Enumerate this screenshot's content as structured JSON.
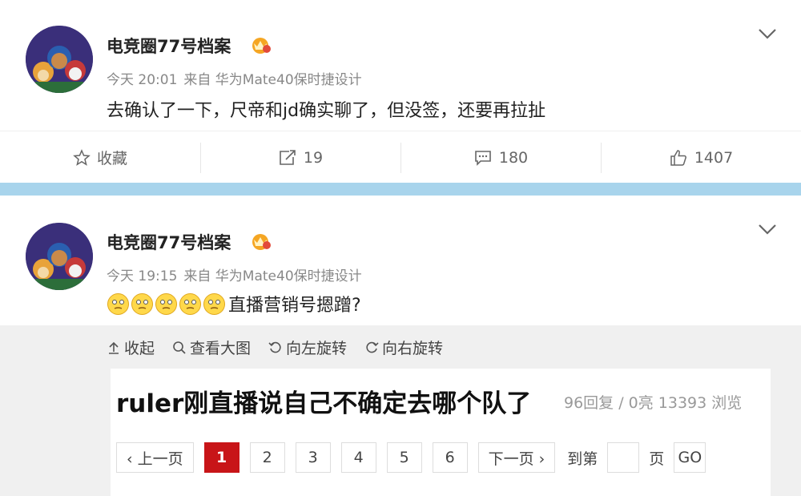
{
  "posts": [
    {
      "username": "电竞圈77号档案",
      "time": "今天 20:01",
      "source": "来自 华为Mate40保时捷设计",
      "content": "去确认了一下，尺帝和jd确实聊了，但没签，还要再拉扯",
      "actions": {
        "favorite": "收藏",
        "repost": "19",
        "comment": "180",
        "like": "1407"
      }
    },
    {
      "username": "电竞圈77号档案",
      "time": "今天 19:15",
      "source": "来自 华为Mate40保时捷设计",
      "emoji_count": 5,
      "content": "直播营销号摁蹭?",
      "toolbar": {
        "collapse": "收起",
        "view_large": "查看大图",
        "rotate_left": "向左旋转",
        "rotate_right": "向右旋转"
      },
      "embed": {
        "title": "ruler刚直播说自己不确定去哪个队了",
        "stats": "96回复 / 0亮 13393 浏览",
        "prev": "‹ 上一页",
        "pages": [
          "1",
          "2",
          "3",
          "4",
          "5",
          "6"
        ],
        "current_page": "1",
        "next": "下一页 ›",
        "goto_label": "到第",
        "goto_suffix": "页",
        "go": "GO"
      }
    }
  ],
  "colors": {
    "separator": "#a8d4ec",
    "active_page": "#c81518",
    "meta_text": "#888888",
    "badge": "#f0a020"
  }
}
